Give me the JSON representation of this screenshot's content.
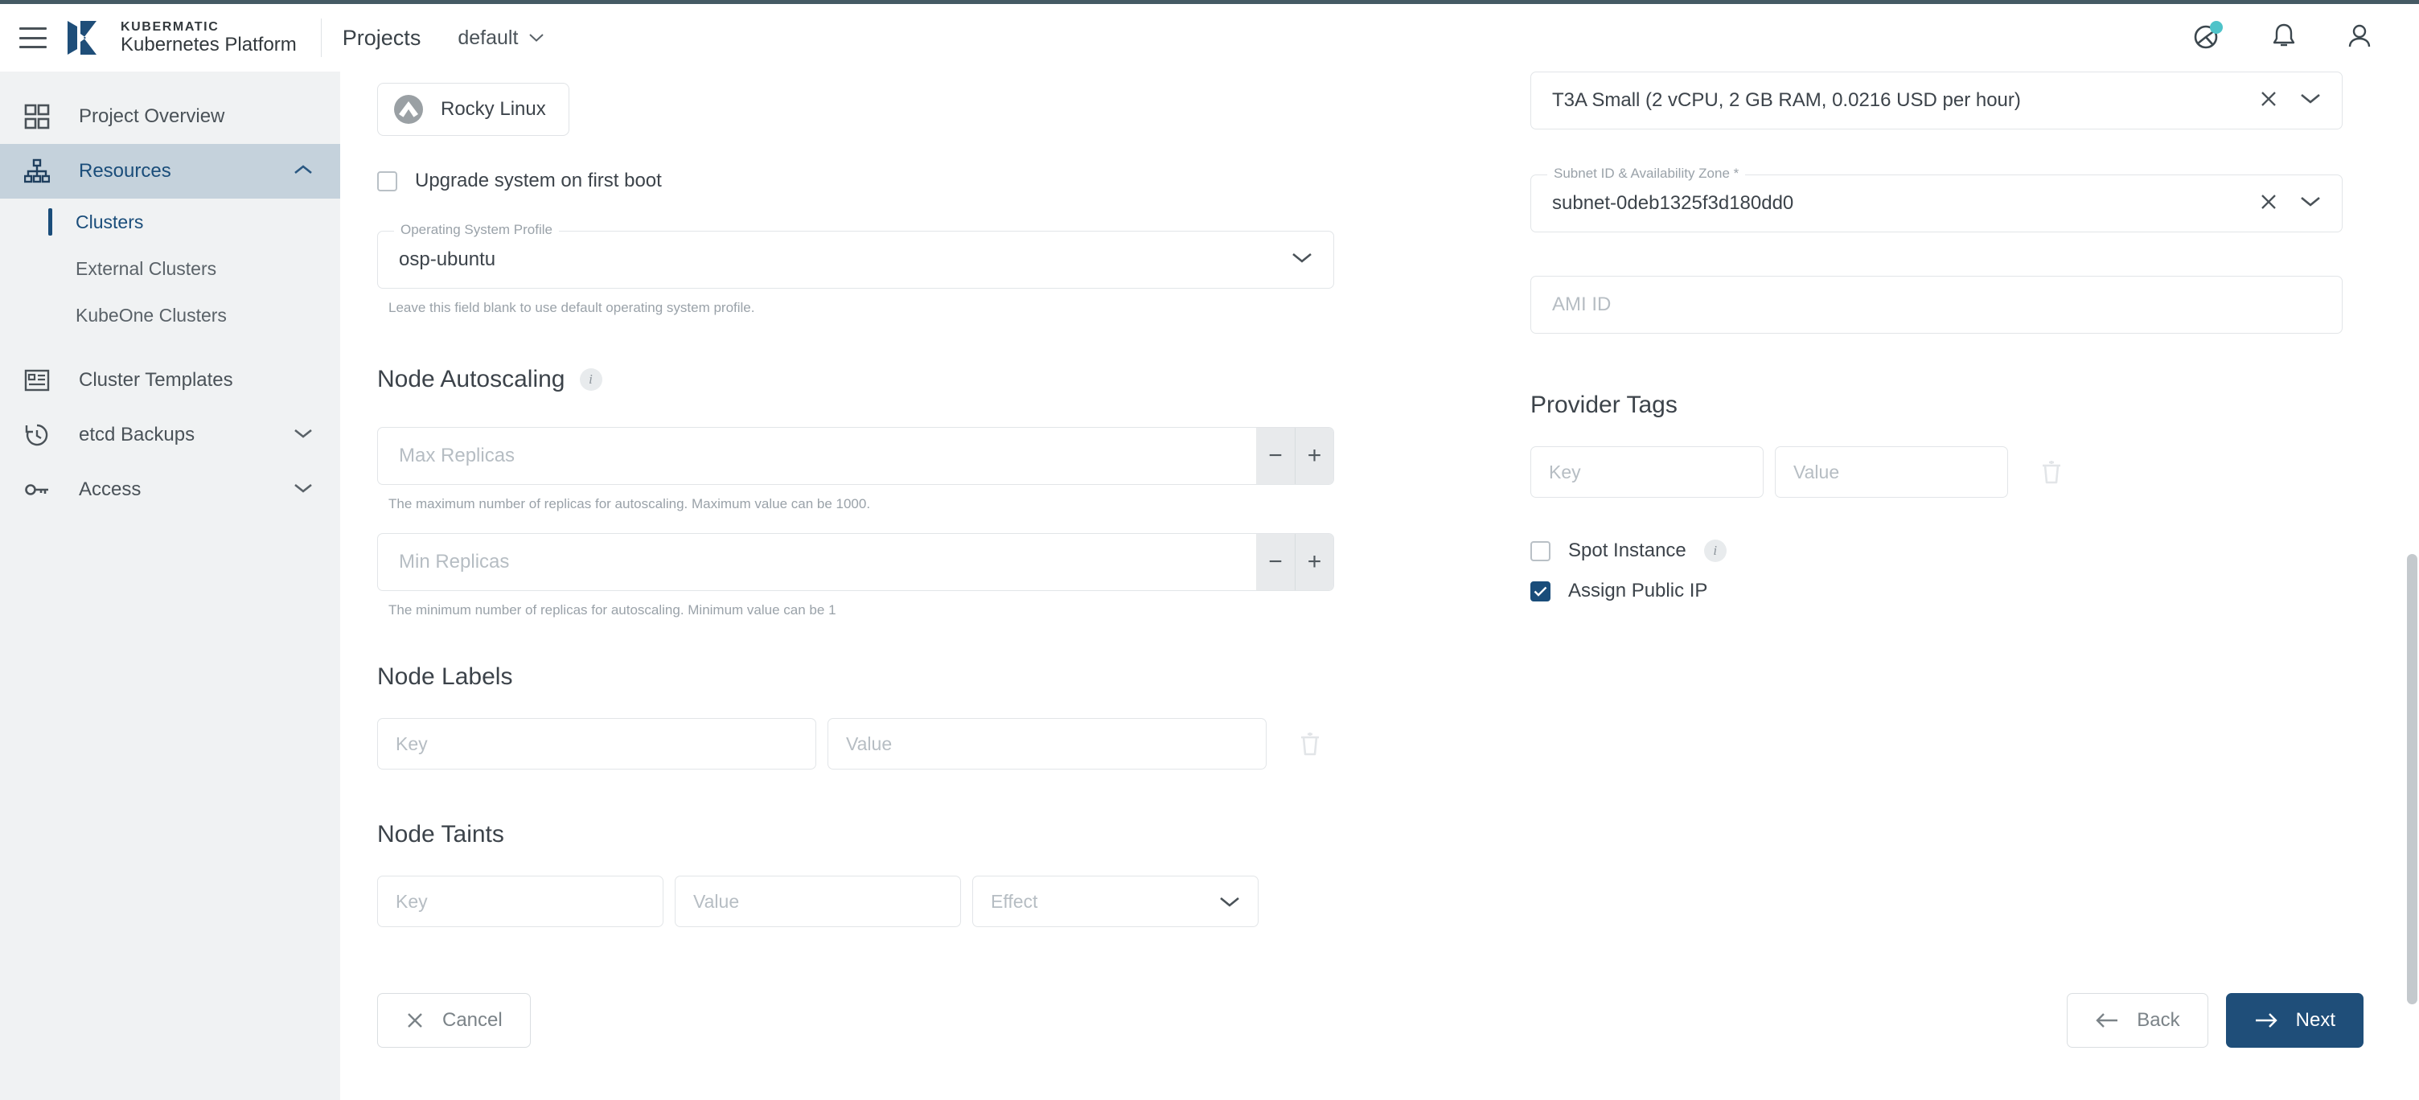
{
  "header": {
    "menu_icon": "hamburger-menu-icon",
    "brand_top": "KUBERMATIC",
    "brand_bottom": "Kubernetes Platform",
    "projects_label": "Projects",
    "project_selected": "default",
    "project_caret_icon": "chevron-down-icon",
    "help_icon": "help-globe-icon",
    "notifications_icon": "bell-icon",
    "account_icon": "user-account-icon"
  },
  "sidebar": {
    "items": [
      {
        "label": "Project Overview",
        "icon": "grid-dashboard-icon",
        "active": false,
        "expandable": false
      },
      {
        "label": "Resources",
        "icon": "resources-hierarchy-icon",
        "active": true,
        "expandable": true,
        "caret": "chevron-up-icon"
      },
      {
        "label": "Cluster Templates",
        "icon": "cluster-templates-icon",
        "active": false,
        "expandable": false
      },
      {
        "label": "etcd Backups",
        "icon": "backup-history-icon",
        "active": false,
        "expandable": true,
        "caret": "chevron-down-icon"
      },
      {
        "label": "Access",
        "icon": "key-icon",
        "active": false,
        "expandable": true,
        "caret": "chevron-down-icon"
      }
    ],
    "sub_items": [
      {
        "label": "Clusters",
        "selected": true
      },
      {
        "label": "External Clusters",
        "selected": false
      },
      {
        "label": "KubeOne Clusters",
        "selected": false
      }
    ]
  },
  "form": {
    "os_chip": {
      "label": "Rocky Linux",
      "icon": "rocky-linux-logo-icon"
    },
    "upgrade_checkbox": {
      "label": "Upgrade system on first boot",
      "checked": false
    },
    "osp": {
      "legend": "Operating System Profile",
      "value": "osp-ubuntu",
      "hint": "Leave this field blank to use default operating system profile.",
      "caret_icon": "chevron-down-icon"
    },
    "autoscaling": {
      "title": "Node Autoscaling",
      "info_icon": "info-icon",
      "max": {
        "placeholder": "Max Replicas",
        "hint": "The maximum number of replicas for autoscaling. Maximum value can be 1000.",
        "minus": "−",
        "plus": "+"
      },
      "min": {
        "placeholder": "Min Replicas",
        "hint": "The minimum number of replicas for autoscaling. Minimum value can be 1",
        "minus": "−",
        "plus": "+"
      }
    },
    "node_labels": {
      "title": "Node Labels",
      "key_placeholder": "Key",
      "value_placeholder": "Value",
      "delete_icon": "trash-delete-icon"
    },
    "node_taints": {
      "title": "Node Taints",
      "key_placeholder": "Key",
      "value_placeholder": "Value",
      "effect_placeholder": "Effect",
      "effect_caret_icon": "chevron-down-icon"
    },
    "instance_type": {
      "value": "T3A Small (2 vCPU, 2 GB RAM, 0.0216 USD per hour)",
      "clear_icon": "clear-x-icon",
      "caret_icon": "chevron-down-icon"
    },
    "subnet": {
      "legend": "Subnet ID & Availability Zone *",
      "value": "subnet-0deb1325f3d180dd0",
      "clear_icon": "clear-x-icon",
      "caret_icon": "chevron-down-icon"
    },
    "ami": {
      "placeholder": "AMI ID"
    },
    "provider_tags": {
      "title": "Provider Tags",
      "key_placeholder": "Key",
      "value_placeholder": "Value",
      "delete_icon": "trash-delete-icon"
    },
    "spot_instance": {
      "label": "Spot Instance",
      "checked": false,
      "info_icon": "info-icon"
    },
    "assign_public_ip": {
      "label": "Assign Public IP",
      "checked": true
    }
  },
  "footer": {
    "cancel": {
      "label": "Cancel",
      "icon": "close-x-icon"
    },
    "back": {
      "label": "Back",
      "icon": "arrow-left-icon"
    },
    "next": {
      "label": "Next",
      "icon": "arrow-right-icon"
    }
  },
  "colors": {
    "accent": "#1f4e79",
    "sidebar_active": "#c5d2dc",
    "badge_teal": "#4ec3c9",
    "top_strip": "#455a64"
  }
}
